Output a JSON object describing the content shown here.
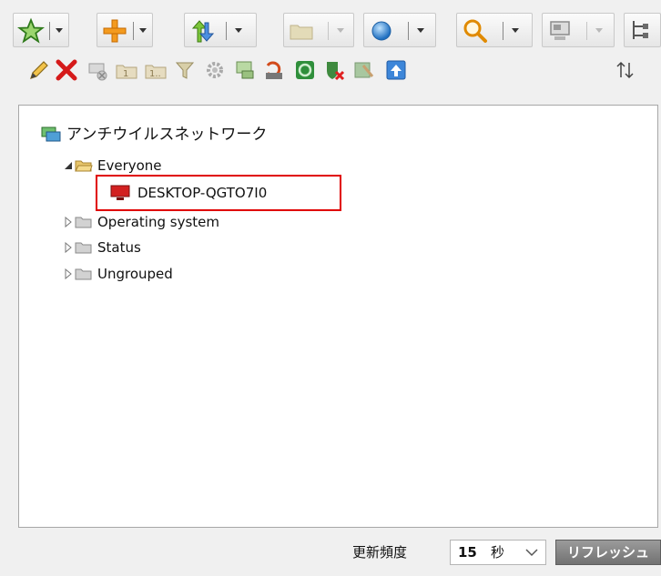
{
  "tree": {
    "root_label": "アンチウイルスネットワーク",
    "nodes": [
      {
        "label": "Everyone",
        "state": "expanded"
      },
      {
        "label": "DESKTOP-QGTO7I0",
        "state": "leaf",
        "highlighted": true
      },
      {
        "label": "Operating system",
        "state": "collapsed"
      },
      {
        "label": "Status",
        "state": "collapsed"
      },
      {
        "label": "Ungrouped",
        "state": "collapsed"
      }
    ]
  },
  "footer": {
    "update_frequency_label": "更新頻度",
    "frequency_value": "15",
    "frequency_unit": "秒",
    "refresh_button": "リフレッシュ"
  },
  "toolbar_row1_icons": [
    "star-icon",
    "plus-icon",
    "move-arrows-icon",
    "folder-icon",
    "sphere-icon",
    "magnifier-icon",
    "computer-icon",
    "tree-icon"
  ],
  "toolbar_row2_icons": [
    "pencil-icon",
    "delete-x-icon",
    "remove-station-icon",
    "folder-1-icon",
    "folder-1-more-icon",
    "filter-icon",
    "gear-icon",
    "install-icon",
    "uninstall-icon",
    "update-icon",
    "restart-shield-icon",
    "repair-icon",
    "upload-icon",
    "sort-arrows-icon"
  ],
  "colors": {
    "highlight_border": "#e00000",
    "station_red": "#d22020",
    "folder_yellow": "#e8c66b",
    "folder_gray": "#d2d2d2"
  }
}
